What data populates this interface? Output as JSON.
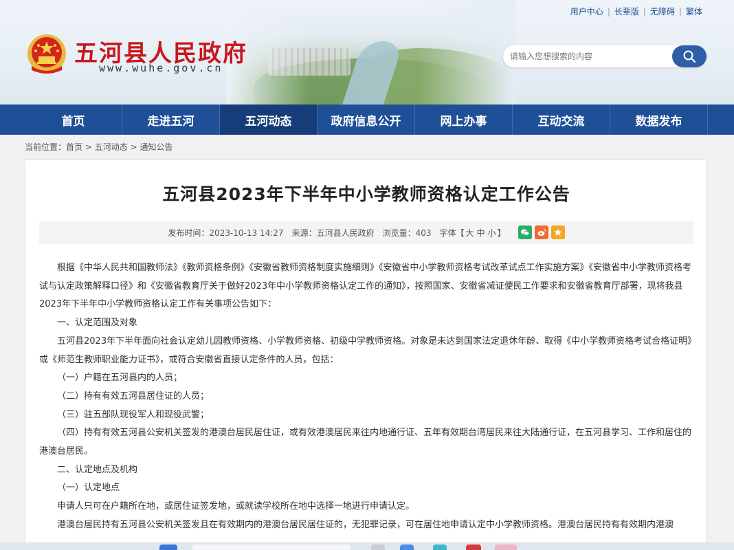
{
  "header": {
    "site_name": "五河县人民政府",
    "domain": "www.wuhe.gov.cn",
    "top_links": [
      "用户中心",
      "长辈版",
      "无障碍",
      "繁体"
    ],
    "search_placeholder": "请输入您想搜索的内容"
  },
  "nav": {
    "items": [
      "首页",
      "走进五河",
      "五河动态",
      "政府信息公开",
      "网上办事",
      "互动交流",
      "数据发布"
    ],
    "active": "五河动态"
  },
  "breadcrumb": {
    "label": "当前位置：",
    "items": [
      "首页",
      "五河动态",
      "通知公告"
    ],
    "sep": ">"
  },
  "article": {
    "title": "五河县2023年下半年中小学教师资格认定工作公告",
    "meta": {
      "publish_label": "发布时间：",
      "publish_time": "2023-10-13 14:27",
      "source_label": "来源：",
      "source": "五河县人民政府",
      "views_label": "浏览量：",
      "views": "403",
      "font_label": "字体【",
      "font_sizes": [
        "大",
        "中",
        "小"
      ],
      "font_end": "】"
    },
    "paragraphs": [
      "根据《中华人民共和国教师法》《教师资格条例》《安徽省教师资格制度实施细则》《安徽省中小学教师资格考试改革试点工作实施方案》《安徽省中小学教师资格考试与认定政策解释口径》和《安徽省教育厅关于做好2023年中小学教师资格认定工作的通知》，按照国家、安徽省减证便民工作要求和安徽省教育厅部署，现将我县2023年下半年中小学教师资格认定工作有关事项公告如下：",
      "一、认定范围及对象",
      "五河县2023年下半年面向社会认定幼儿园教师资格、小学教师资格、初级中学教师资格。对象是未达到国家法定退休年龄、取得《中小学教师资格考试合格证明》或《师范生教师职业能力证书》，或符合安徽省直接认定条件的人员，包括：",
      "（一）户籍在五河县内的人员；",
      "（二）持有有效五河县居住证的人员；",
      "（三）驻五部队现役军人和现役武警；",
      "（四）持有有效五河县公安机关签发的港澳台居民居住证，或有效港澳居民来往内地通行证、五年有效期台湾居民来往大陆通行证，在五河县学习、工作和居住的港澳台居民。",
      "二、认定地点及机构",
      "（一）认定地点",
      "申请人只可在户籍所在地，或居住证签发地，或就读学校所在地中选择一地进行申请认定。",
      "港澳台居民持有五河县公安机关签发且在有效期内的港澳台居民居住证的，无犯罪记录，可在居住地申请认定中小学教师资格。港澳台居民持有有效期内港澳"
    ]
  },
  "colors": {
    "brand_red": "#c8161d",
    "nav_blue": "#1f4f97",
    "nav_active": "#163d7a"
  }
}
